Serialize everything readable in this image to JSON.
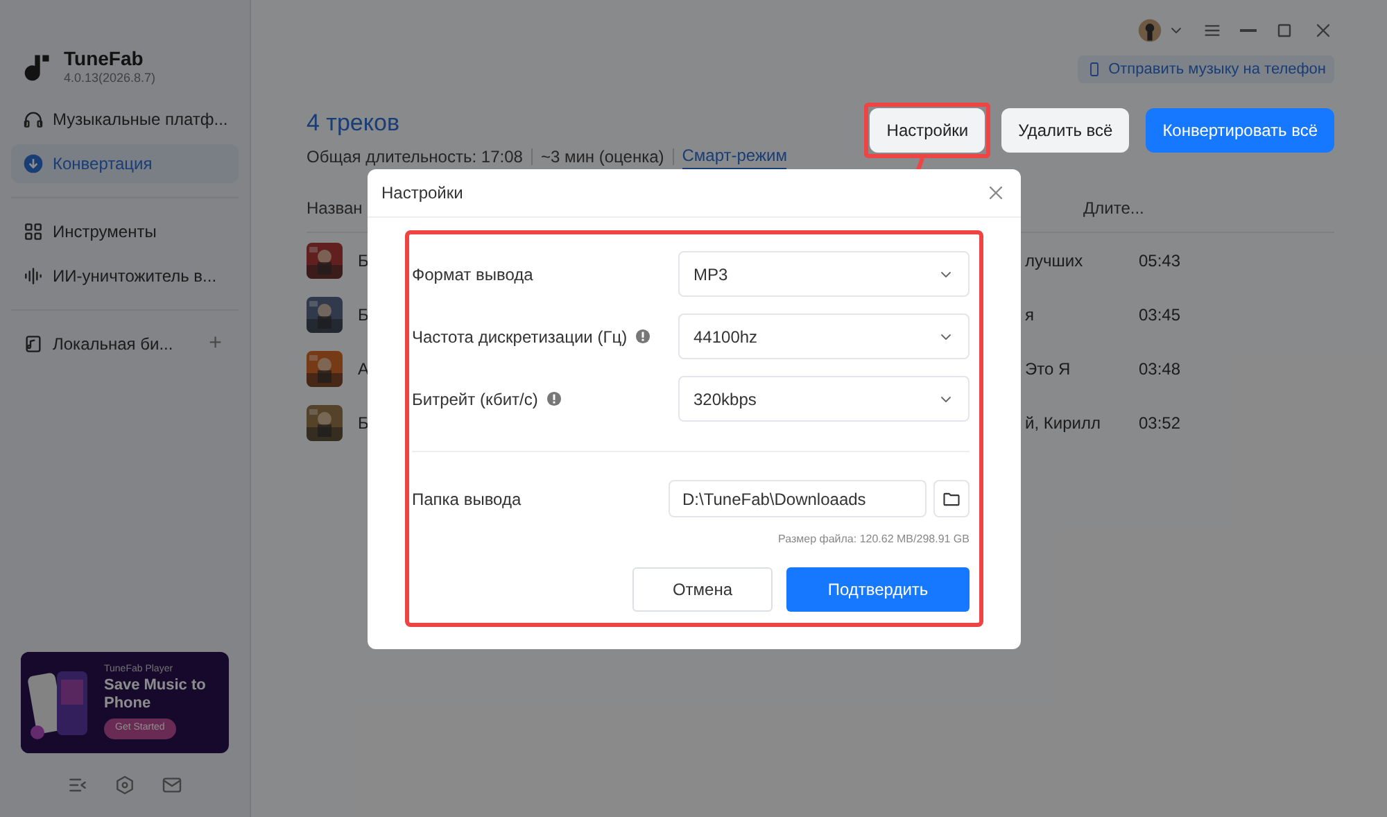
{
  "app": {
    "name": "TuneFab",
    "version": "4.0.13(2026.8.7)"
  },
  "top_bar": {
    "send_to_phone": "Отправить музыку на телефон"
  },
  "sidebar": {
    "groups": [
      {
        "items": [
          {
            "label": "Музыкальные платф...",
            "selected": false
          },
          {
            "label": "Конвертация",
            "selected": true
          }
        ]
      },
      {
        "items": [
          {
            "label": "Инструменты",
            "selected": false
          },
          {
            "label": "ИИ-уничтожитель в...",
            "selected": false
          }
        ]
      },
      {
        "items": [
          {
            "label": "Локальная би...",
            "selected": false,
            "add": "+"
          }
        ]
      }
    ],
    "promo": {
      "brand": "TuneFab Player",
      "headline": "Save Music to Phone",
      "button": "Get Started"
    }
  },
  "header": {
    "title": "4 треков",
    "total": "Общая длительность: 17:08",
    "estimate": "~3 мин (оценка)",
    "smart_mode": "Смарт-режим",
    "buttons": [
      {
        "label": "Настройки",
        "kind": "secondary"
      },
      {
        "label": "Удалить всё",
        "kind": "secondary"
      },
      {
        "label": "Конвертировать всё",
        "kind": "primary"
      }
    ]
  },
  "table": {
    "columns": [
      "Назван",
      "Длите..."
    ],
    "rows": [
      {
        "title": "Б",
        "artist": "лучших",
        "duration": "05:43"
      },
      {
        "title": "Б",
        "artist": "я",
        "duration": "03:45"
      },
      {
        "title": "А",
        "artist": "Это Я",
        "duration": "03:48"
      },
      {
        "title": "Б",
        "artist": "й, Кирилл",
        "duration": "03:52"
      }
    ]
  },
  "dialog": {
    "title": "Настройки",
    "fields": [
      {
        "label": "Формат вывода",
        "value": "MP3",
        "info": false
      },
      {
        "label": "Частота дискретизации (Гц)",
        "value": "44100hz",
        "info": true
      },
      {
        "label": "Битрейт (кбит/с)",
        "value": "320kbps",
        "info": true
      }
    ],
    "folder": {
      "label": "Папка вывода",
      "value": "D:\\TuneFab\\Downloaads"
    },
    "file_size": "Размер файла: 120.62 MB/298.91 GB",
    "cancel": "Отмена",
    "confirm": "Подтвердить"
  }
}
